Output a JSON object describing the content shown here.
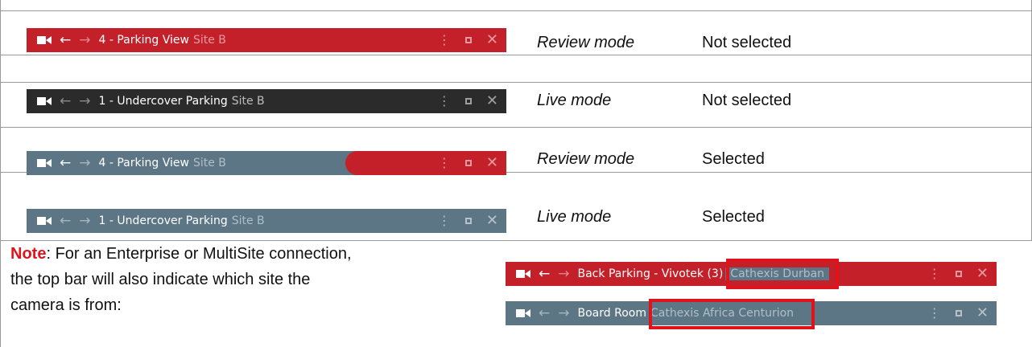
{
  "rows": [
    {
      "bar": {
        "style": "red",
        "title": "4 - Parking View",
        "site": "Site B",
        "back_enabled": true
      },
      "mode": "Review mode",
      "status": "Not selected"
    },
    {
      "bar": {
        "style": "dark",
        "title": "1 - Undercover Parking",
        "site": "Site B",
        "back_enabled": false
      },
      "mode": "Live mode",
      "status": "Not selected"
    },
    {
      "bar": {
        "style": "slate-with-red-pill",
        "title": "4 - Parking View",
        "site": "Site B",
        "back_enabled": true
      },
      "mode": "Review mode",
      "status": "Selected"
    },
    {
      "bar": {
        "style": "slate",
        "title": "1 - Undercover Parking",
        "site": "Site B",
        "back_enabled": false
      },
      "mode": "Live mode",
      "status": "Selected"
    }
  ],
  "note": {
    "label": "Note",
    "text": ": For an Enterprise or MultiSite connection, the top bar will also indicate which site the camera is from:"
  },
  "examples": [
    {
      "title": "Back Parking - Vivotek (3)",
      "site": "Cathexis Durban",
      "style": "red-review"
    },
    {
      "title": "Board Room",
      "site": "Cathexis Africa Centurion",
      "style": "slate"
    }
  ],
  "colors": {
    "review_red": "#c4202a",
    "live_dark": "#2b2b2b",
    "selected_slate": "#5d7686",
    "highlight_red": "#e0121b",
    "note_red": "#e0121b"
  },
  "icons": [
    "video-camera-icon",
    "arrow-left-icon",
    "arrow-right-icon",
    "vertical-dots-icon",
    "maximize-icon",
    "close-icon"
  ]
}
